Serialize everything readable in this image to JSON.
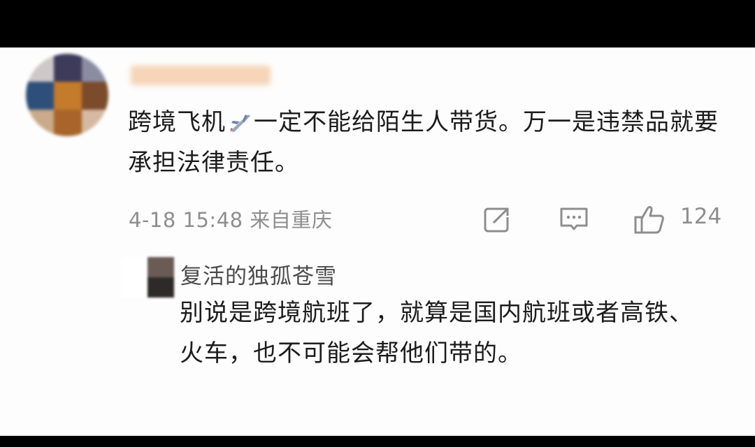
{
  "comment": {
    "author_name": "",
    "text_part1": "跨境飞机",
    "text_part2": "一定不能给陌生人带货。万一是违禁品就要承担法律责任。",
    "emoji_icon": "airplane-icon",
    "timestamp": "4-18 15:48",
    "location": "来自重庆",
    "like_count": "124",
    "actions": [
      "share-icon",
      "comment-icon",
      "like-icon"
    ]
  },
  "reply": {
    "author_name": "复活的独孤苍雪",
    "text": "别说是跨境航班了，就算是国内航班或者高铁、火车，也不可能会帮他们带的。"
  }
}
